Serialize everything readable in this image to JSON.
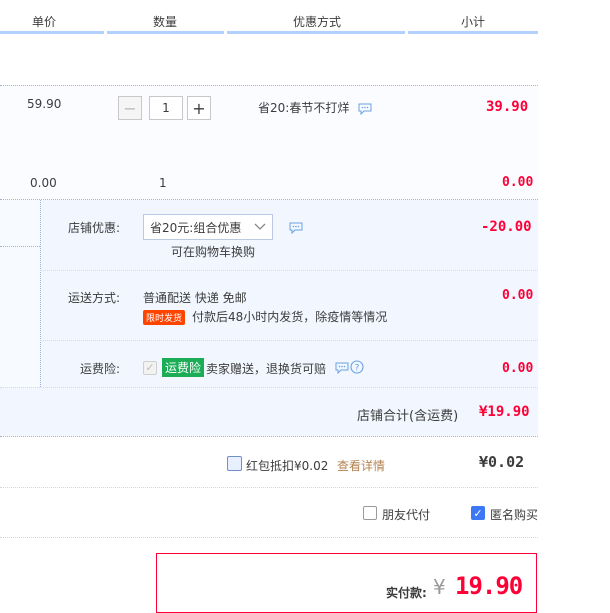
{
  "header": {
    "unit_price": "单价",
    "quantity": "数量",
    "discount_method": "优惠方式",
    "subtotal": "小计"
  },
  "item1": {
    "unit_price": "59.90",
    "quantity": "1",
    "discount": "省20:春节不打烊",
    "subtotal": "39.90"
  },
  "item2": {
    "unit_price": "0.00",
    "quantity": "1",
    "subtotal": "0.00"
  },
  "shop": {
    "discount_label": "店铺优惠:",
    "discount_select": "省20元:组合优惠",
    "discount_sub": "可在购物车换购",
    "discount_amount": "-20.00",
    "shipping_label": "运送方式:",
    "shipping_value": "普通配送 快递 免邮",
    "shipping_tag": "限时发货",
    "shipping_note": "付款后48小时内发货，除疫情等情况",
    "shipping_amount": "0.00",
    "insurance_label": "运费险:",
    "insurance_tag": "运费险",
    "insurance_note": "卖家赠送，退换货可赔",
    "insurance_amount": "0.00",
    "total_label": "店铺合计(含运费)",
    "total_amount": "¥19.90"
  },
  "redpacket": {
    "label": "红包抵扣¥0.02",
    "link": "查看详情",
    "amount": "¥0.02"
  },
  "options": {
    "friend_pay": "朋友代付",
    "anonymous": "匿名购买"
  },
  "payment": {
    "label": "实付款:",
    "currency": "¥",
    "amount": "19.90"
  },
  "colors": {
    "accent_red": "#ff0036",
    "header_line": "#b2d1ff",
    "shop_panel": "#f2f7ff",
    "checkbox_blue": "#3c77f5",
    "link_brown": "#b28350"
  }
}
